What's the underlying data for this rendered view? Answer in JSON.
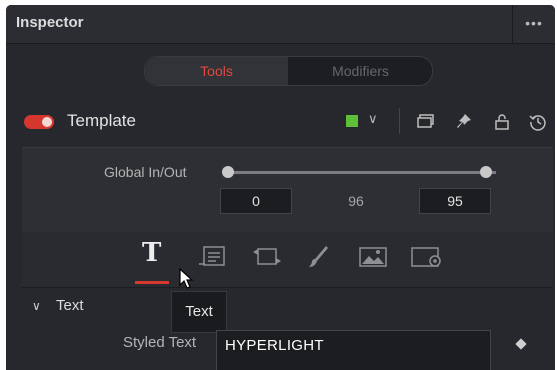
{
  "panel": {
    "title": "Inspector",
    "more": "•••"
  },
  "tabs": {
    "tools": "Tools",
    "modifiers": "Modifiers"
  },
  "node": {
    "name": "Template",
    "enabled": true,
    "color": "#5fbf3a",
    "chevron": "∨",
    "icons": [
      "duplicate-icon",
      "pin-icon",
      "lock-icon",
      "reset-icon"
    ]
  },
  "global_in_out": {
    "label": "Global In/Out",
    "in": "0",
    "duration": "96",
    "out": "95"
  },
  "tool_icons": {
    "text": "T",
    "items": [
      "text-icon",
      "layout-icon",
      "transform-icon",
      "shading-icon",
      "image-icon",
      "settings-icon"
    ]
  },
  "tooltip": "Text",
  "section": {
    "chevron": "∨",
    "title": "Text"
  },
  "styled_text": {
    "label": "Styled Text",
    "value": "HYPERLIGHT"
  },
  "colors": {
    "accent": "#d8392f",
    "panel_bg": "#27282d"
  }
}
